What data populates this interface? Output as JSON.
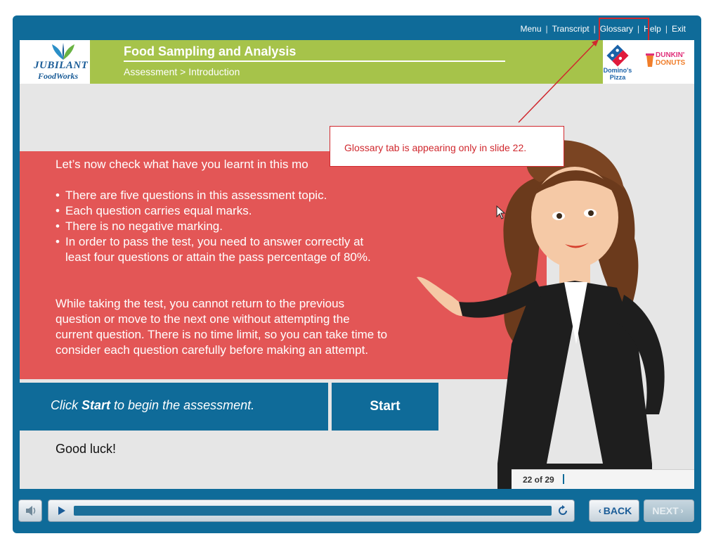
{
  "nav": {
    "items": [
      "Menu",
      "Transcript",
      "Glossary",
      "Help",
      "Exit"
    ]
  },
  "header": {
    "course_title": "Food Sampling and Analysis",
    "breadcrumb": "Assessment > Introduction",
    "logo_jubilant_line1": "JUBILANT",
    "logo_jubilant_line2": "FoodWorks",
    "logo_dominos_line1": "Domino's",
    "logo_dominos_line2": "Pizza",
    "logo_dunkin_line1": "DUNKIN'",
    "logo_dunkin_line2": "DONUTS"
  },
  "content": {
    "intro": "Let’s now check what have you learnt in this mo",
    "bullets": [
      "There are five questions in this assessment topic.",
      "Each question carries equal marks.",
      "There is no negative marking.",
      "In order to pass the test, you need to answer correctly at least four questions or attain the pass percentage of 80%."
    ],
    "paragraph": "While taking the test, you cannot return to the previous question or move to the next one without attempting the current question. There is no time limit, so you can take time to consider each question carefully before making an attempt.",
    "cta_prefix": "Click ",
    "cta_bold": "Start",
    "cta_suffix": " to begin the assessment.",
    "start_label": "Start",
    "good_luck": "Good luck!"
  },
  "callout": {
    "text": "Glossary tab is appearing only in slide 22."
  },
  "slide_counter": "22 of 29",
  "controls": {
    "back_label": "BACK",
    "next_label": "NEXT",
    "progress": 0.0
  },
  "colors": {
    "frame_blue": "#0f6b99",
    "header_green": "#a6c34a",
    "content_red": "#e35656",
    "annotation_red": "#d0282e"
  }
}
